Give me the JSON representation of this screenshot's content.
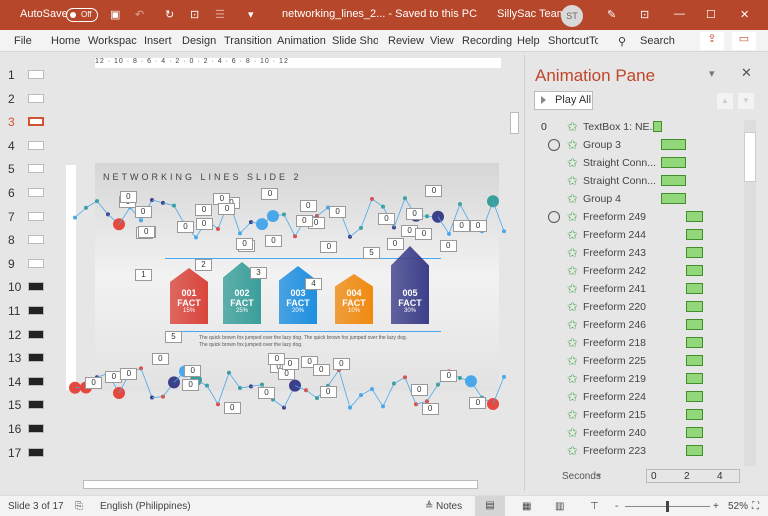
{
  "titlebar": {
    "autosave": "AutoSave",
    "autosave_state": "Off",
    "filename": "networking_lines_2...  -  Saved to this PC",
    "user": "SillySac Team",
    "initials": "ST",
    "accent": "#b7472a"
  },
  "ribbon": {
    "tabs": [
      "File",
      "Home",
      "Workspac",
      "Insert",
      "Design",
      "Transition",
      "Animation",
      "Slide Show",
      "Review",
      "View",
      "Recording",
      "Help",
      "ShortcutTo"
    ],
    "search": "Search"
  },
  "thumbnails": {
    "numbers": [
      "1",
      "2",
      "3",
      "4",
      "5",
      "6",
      "7",
      "8",
      "9",
      "10",
      "11",
      "12",
      "13",
      "14",
      "15",
      "16",
      "17"
    ],
    "selected": 3
  },
  "ruler": {
    "h": "12 · 10 · 8 · 6 · 4 · 2 · 0 · 2 · 4 · 6 · 8 · 10 · 12"
  },
  "slide": {
    "title": "NETWORKING LINES SLIDE 2",
    "facts": [
      {
        "num": "001",
        "label": "FACT",
        "pct": "15%",
        "color": "#d9453c"
      },
      {
        "num": "002",
        "label": "FACT",
        "pct": "25%",
        "color": "#3a9e9a"
      },
      {
        "num": "003",
        "label": "FACT",
        "pct": "20%",
        "color": "#1e8fe0"
      },
      {
        "num": "004",
        "label": "FACT",
        "pct": "10%",
        "color": "#ef8a10"
      },
      {
        "num": "005",
        "label": "FACT",
        "pct": "30%",
        "color": "#3d3f8a"
      }
    ],
    "body": "The quick brown fox jumped over the lazy dog. The quick brown fox jumped over the lazy dog. The quick brown fox jumped over the lazy dog.",
    "tags": [
      "0",
      "0",
      "0",
      "0",
      "0",
      "0",
      "0",
      "0",
      "0",
      "0",
      "0",
      "0",
      "0",
      "0",
      "0",
      "0",
      "0",
      "0",
      "0",
      "0",
      "0",
      "0",
      "0",
      "0",
      "0",
      "0",
      "0",
      "0",
      "0",
      "0",
      "1",
      "2",
      "3",
      "4",
      "5",
      "5",
      "0",
      "0",
      "0",
      "0",
      "0",
      "0",
      "0",
      "0",
      "0",
      "0",
      "0",
      "0",
      "0",
      "0",
      "0",
      "0",
      "0",
      "0",
      "0",
      "0"
    ]
  },
  "pane": {
    "title": "Animation Pane",
    "play_all": "Play All",
    "items": [
      {
        "num": "0",
        "label": "TextBox 1: NE...",
        "clock": false,
        "bar": "small"
      },
      {
        "label": "Group 3",
        "clock": true,
        "bar": "a"
      },
      {
        "label": "Straight Conn...",
        "bar": "a"
      },
      {
        "label": "Straight Conn...",
        "bar": "a"
      },
      {
        "label": "Group 4",
        "bar": "a"
      },
      {
        "label": "Freeform 249",
        "clock": true,
        "bar": "b"
      },
      {
        "label": "Freeform 244",
        "bar": "b"
      },
      {
        "label": "Freeform 243",
        "bar": "b"
      },
      {
        "label": "Freeform 242",
        "bar": "b"
      },
      {
        "label": "Freeform 241",
        "bar": "b"
      },
      {
        "label": "Freeform 220",
        "bar": "b"
      },
      {
        "label": "Freeform 246",
        "bar": "b"
      },
      {
        "label": "Freeform 218",
        "bar": "b"
      },
      {
        "label": "Freeform 225",
        "bar": "b"
      },
      {
        "label": "Freeform 219",
        "bar": "b"
      },
      {
        "label": "Freeform 224",
        "bar": "b"
      },
      {
        "label": "Freeform 215",
        "bar": "b"
      },
      {
        "label": "Freeform 240",
        "bar": "b"
      },
      {
        "label": "Freeform 223",
        "bar": "b"
      }
    ],
    "seconds": "Seconds",
    "timeline": [
      "0",
      "2",
      "4"
    ]
  },
  "status": {
    "slide": "Slide 3 of 17",
    "language": "English (Philippines)",
    "notes": "Notes",
    "zoom": "52%",
    "zoom_level": 0.52
  }
}
